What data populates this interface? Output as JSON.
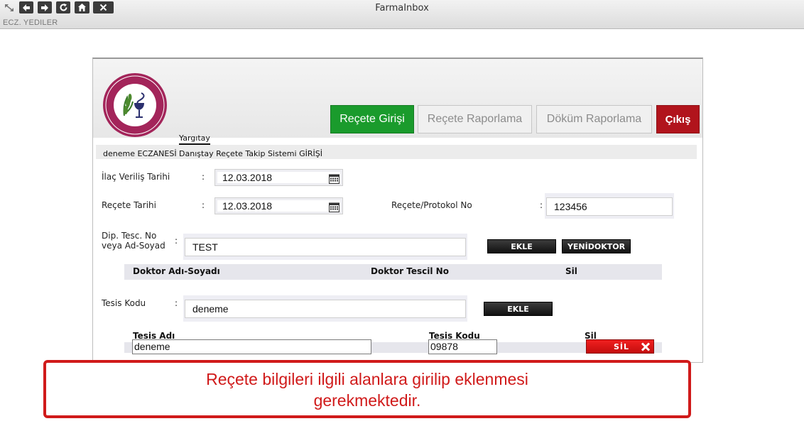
{
  "window": {
    "app_title": "FarmaInbox",
    "subtitle": "ECZ. YEDILER"
  },
  "nav": {
    "recete_girisi": "Reçete Girişi",
    "recete_raporlama": "Reçete Raporlama",
    "dokum_raporlama": "Döküm Raporlama",
    "cikis": "Çıkış"
  },
  "header": {
    "yargitay": "Yargıtay",
    "info": "deneme ECZANESİ Danıştay Reçete Takip Sistemi GİRİŞİ"
  },
  "form": {
    "ilac_verilis_label": "İlaç Veriliş Tarihi",
    "ilac_verilis_value": "12.03.2018",
    "recete_tarihi_label": "Reçete Tarihi",
    "recete_tarihi_value": "12.03.2018",
    "protokol_label": "Reçete/Protokol No",
    "protokol_value": "123456",
    "dip_label_line1": "Dip. Tesc. No",
    "dip_label_line2": "veya Ad-Soyad",
    "dip_value": "TEST",
    "ekle_label": "EKLE",
    "yenidoktor_label": "YENİDOKTOR",
    "tesis_kodu_label": "Tesis Kodu",
    "tesis_kodu_value": "deneme",
    "ekle2_label": "EKLE",
    "colon": ":"
  },
  "doctor_table": {
    "headers": [
      "Doktor Adı-Soyadı",
      "Doktor Tescil No",
      "Sil"
    ]
  },
  "tesis_table": {
    "headers": [
      "Tesis Adı",
      "Tesis Kodu",
      "Sil"
    ],
    "row": {
      "tesis_adi": "deneme",
      "tesis_kodu": "09878",
      "sil_label": "SİL"
    }
  },
  "callout": {
    "line1": "Reçete bilgileri ilgili alanlara girilip eklenmesi",
    "line2": "gerekmektedir."
  },
  "colors": {
    "green": "#1a9b2c",
    "red": "#b1141c",
    "callout_red": "#d01a1a"
  }
}
